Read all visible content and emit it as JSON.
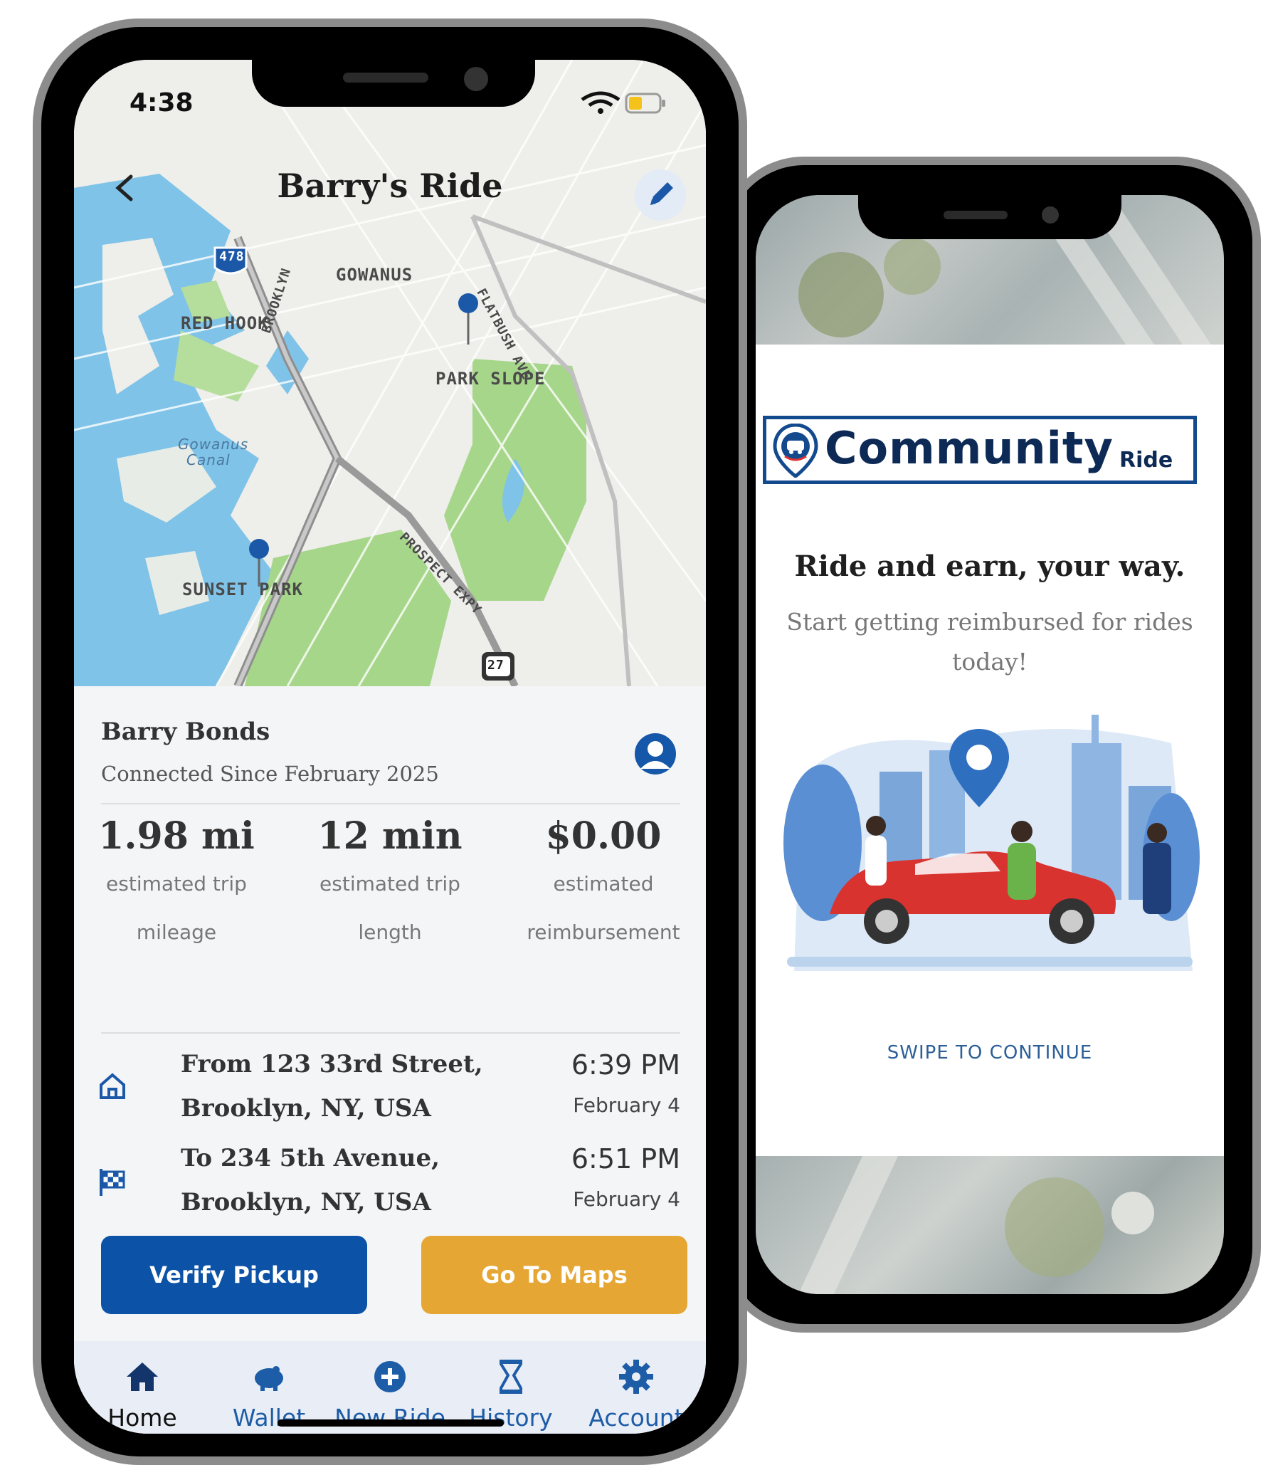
{
  "left_phone": {
    "status": {
      "time": "4:38"
    },
    "map": {
      "title": "Barry's Ride",
      "labels": {
        "gowanus": "GOWANUS",
        "red_hook": "RED HOOK",
        "park_slope": "PARK SLOPE",
        "gowanus_canal_1": "Gowanus",
        "gowanus_canal_2": "Canal",
        "sunset_park": "SUNSET PARK",
        "flatbush": "FLATBUSH AVE",
        "prospect": "PROSPECT EXPY",
        "brooklyn": "BROOKLYN",
        "shield_478": "478",
        "shield_27": "27"
      }
    },
    "driver": {
      "name": "Barry Bonds",
      "subtitle": "Connected Since February 2025"
    },
    "stats": [
      {
        "value": "1.98 mi",
        "label_1": "estimated trip",
        "label_2": "mileage"
      },
      {
        "value": "12 min",
        "label_1": "estimated trip",
        "label_2": "length"
      },
      {
        "value": "$0.00",
        "label_1": "estimated",
        "label_2": "reimbursement"
      }
    ],
    "trip": {
      "from_1": "From 123 33rd Street,",
      "from_2": "Brooklyn, NY, USA",
      "from_time": "6:39 PM",
      "from_date": "February 4",
      "to_1": "To 234 5th Avenue,",
      "to_2": "Brooklyn, NY, USA",
      "to_time": "6:51 PM",
      "to_date": "February 4"
    },
    "buttons": {
      "verify": "Verify Pickup",
      "maps": "Go To Maps"
    },
    "tabs": [
      {
        "label": "Home",
        "icon": "home-icon"
      },
      {
        "label": "Wallet",
        "icon": "piggy-bank-icon"
      },
      {
        "label": "New Ride",
        "icon": "plus-circle-icon"
      },
      {
        "label": "History",
        "icon": "hourglass-icon"
      },
      {
        "label": "Account",
        "icon": "gear-icon"
      }
    ]
  },
  "right_phone": {
    "logo": {
      "main": "Community",
      "sub": "Ride"
    },
    "headline": "Ride and earn, your way.",
    "subtitle": "Start getting reimbursed for rides today!",
    "swipe": "SWIPE TO CONTINUE"
  },
  "colors": {
    "primary": "#0c52a6",
    "accent": "#e6a633",
    "tab_text": "#1d5ca6"
  }
}
